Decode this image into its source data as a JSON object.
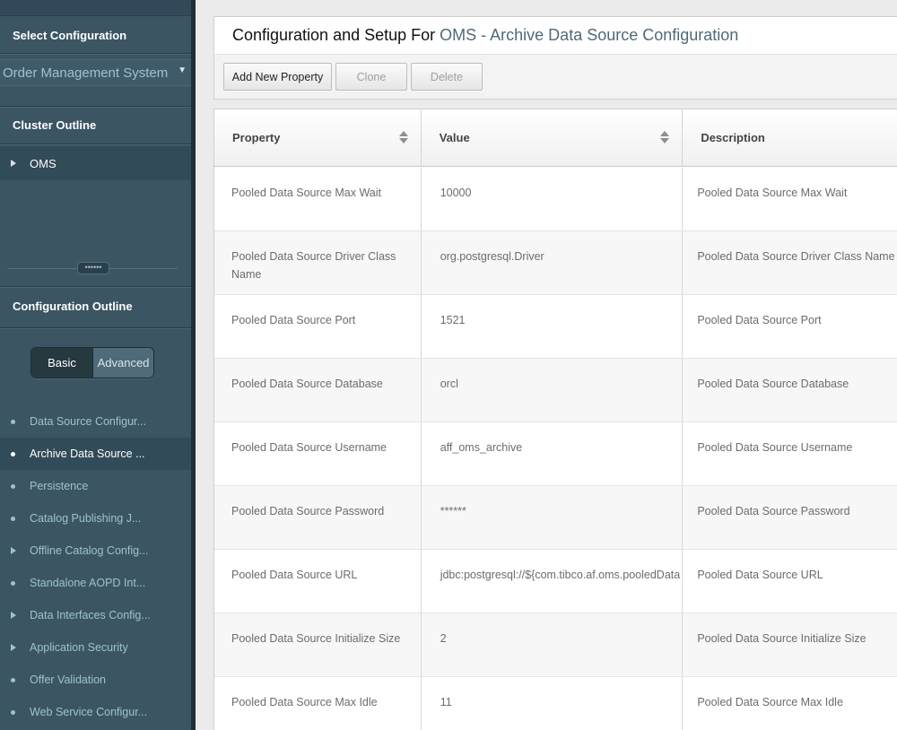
{
  "sidebar": {
    "select_config_header": "Select Configuration",
    "config_selected": "Order Management System",
    "cluster_outline_header": "Cluster Outline",
    "cluster_item": "OMS",
    "splitter_handle": "••••••",
    "config_outline_header": "Configuration Outline",
    "mode_basic": "Basic",
    "mode_advanced": "Advanced",
    "outline_items": [
      {
        "label": "Data Source Configur...",
        "marker": "dot"
      },
      {
        "label": "Archive Data Source ...",
        "marker": "dot",
        "active": true
      },
      {
        "label": "Persistence",
        "marker": "dot"
      },
      {
        "label": "Catalog Publishing J...",
        "marker": "dot"
      },
      {
        "label": "Offline Catalog Config...",
        "marker": "arrow"
      },
      {
        "label": "Standalone AOPD Int...",
        "marker": "dot"
      },
      {
        "label": "Data Interfaces Config...",
        "marker": "arrow"
      },
      {
        "label": "Application Security",
        "marker": "arrow"
      },
      {
        "label": "Offer Validation",
        "marker": "dot"
      },
      {
        "label": "Web Service Configur...",
        "marker": "dot"
      }
    ]
  },
  "header": {
    "title_prefix": "Configuration and Setup For",
    "title_context": "OMS - Archive Data Source Configuration"
  },
  "toolbar": {
    "add_label": "Add New Property",
    "clone_label": "Clone",
    "delete_label": "Delete"
  },
  "grid": {
    "columns": [
      "Property",
      "Value",
      "Description"
    ],
    "rows": [
      {
        "property": "Pooled Data Source Max Wait",
        "value": "10000",
        "description": "Pooled Data Source Max Wait"
      },
      {
        "property": "Pooled Data Source Driver Class Name",
        "value": "org.postgresql.Driver",
        "description": "Pooled Data Source Driver Class Name"
      },
      {
        "property": "Pooled Data Source Port",
        "value": "1521",
        "description": "Pooled Data Source Port"
      },
      {
        "property": "Pooled Data Source Database",
        "value": "orcl",
        "description": "Pooled Data Source Database"
      },
      {
        "property": "Pooled Data Source Username",
        "value": "aff_oms_archive",
        "description": "Pooled Data Source Username"
      },
      {
        "property": "Pooled Data Source Password",
        "value": "******",
        "description": "Pooled Data Source Password"
      },
      {
        "property": "Pooled Data Source URL",
        "value": "jdbc:postgresql://${com.tibco.af.oms.pooledData",
        "description": "Pooled Data Source URL"
      },
      {
        "property": "Pooled Data Source Initialize Size",
        "value": "2",
        "description": "Pooled Data Source Initialize Size"
      },
      {
        "property": "Pooled Data Source Max Idle",
        "value": "11",
        "description": "Pooled Data Source Max Idle"
      }
    ]
  },
  "colors": {
    "sidebar_bg": "#3b5562",
    "sidebar_active": "#324b58",
    "sidebar_link": "#9cc3d0",
    "title_accent": "#4e6a78"
  }
}
